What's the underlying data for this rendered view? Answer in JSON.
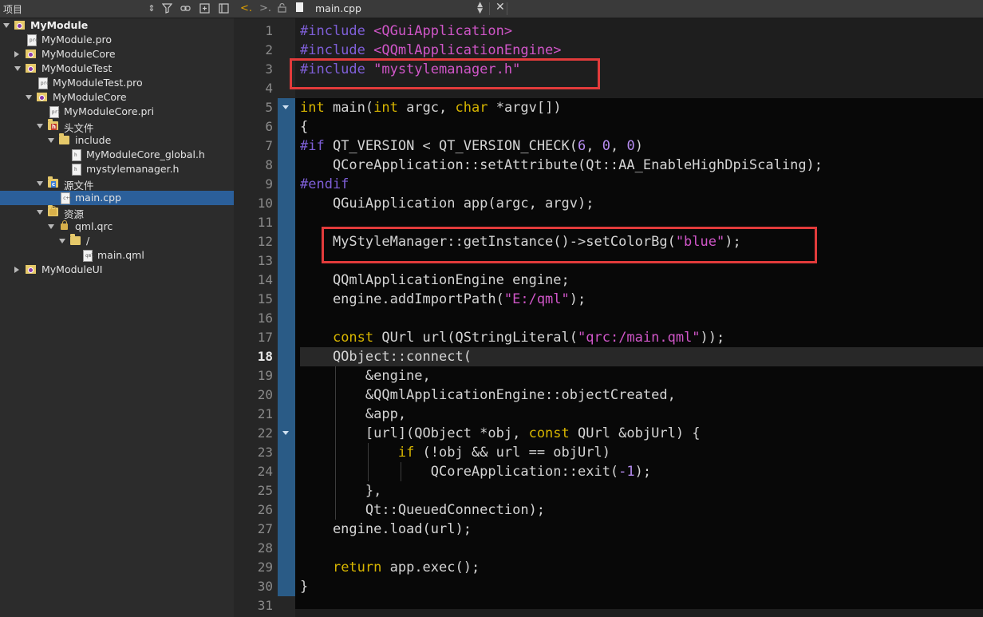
{
  "panel": {
    "title": "项目"
  },
  "tree": [
    {
      "label": "MyModule",
      "icon": "project-icon",
      "bold": true,
      "arrow": "down"
    },
    {
      "label": "MyModule.pro",
      "icon": "pro-file-icon",
      "arrow": ""
    },
    {
      "label": "MyModuleCore",
      "icon": "project-icon",
      "arrow": "right"
    },
    {
      "label": "MyModuleTest",
      "icon": "project-icon",
      "arrow": "down"
    },
    {
      "label": "MyModuleTest.pro",
      "icon": "pro-file-icon",
      "arrow": ""
    },
    {
      "label": "MyModuleCore",
      "icon": "project-icon",
      "arrow": "down"
    },
    {
      "label": "MyModuleCore.pri",
      "icon": "pri-file-icon",
      "arrow": ""
    },
    {
      "label": "头文件",
      "icon": "headers-folder-icon",
      "arrow": "down"
    },
    {
      "label": "include",
      "icon": "folder-icon",
      "arrow": "down"
    },
    {
      "label": "MyModuleCore_global.h",
      "icon": "header-file-icon",
      "arrow": ""
    },
    {
      "label": "mystylemanager.h",
      "icon": "header-file-icon",
      "arrow": ""
    },
    {
      "label": "源文件",
      "icon": "sources-folder-icon",
      "arrow": "down"
    },
    {
      "label": "main.cpp",
      "icon": "cpp-file-icon",
      "arrow": "",
      "selected": true
    },
    {
      "label": "资源",
      "icon": "resources-folder-icon",
      "arrow": "down"
    },
    {
      "label": "qml.qrc",
      "icon": "qrc-file-icon",
      "arrow": "down"
    },
    {
      "label": "/",
      "icon": "folder-icon",
      "arrow": "down"
    },
    {
      "label": "main.qml",
      "icon": "qml-file-icon",
      "arrow": ""
    },
    {
      "label": "MyModuleUI",
      "icon": "project-icon",
      "arrow": "right"
    }
  ],
  "editor": {
    "file_name": "main.cpp",
    "current_line": 18
  },
  "code_lines": [
    "#include <QGuiApplication>",
    "#include <QQmlApplicationEngine>",
    "#include \"mystylemanager.h\"",
    "",
    "int main(int argc, char *argv[])",
    "{",
    "#if QT_VERSION < QT_VERSION_CHECK(6, 0, 0)",
    "    QCoreApplication::setAttribute(Qt::AA_EnableHighDpiScaling);",
    "#endif",
    "    QGuiApplication app(argc, argv);",
    "",
    "    MyStyleManager::getInstance()->setColorBg(\"blue\");",
    "",
    "    QQmlApplicationEngine engine;",
    "    engine.addImportPath(\"E:/qml\");",
    "",
    "    const QUrl url(QStringLiteral(\"qrc:/main.qml\"));",
    "    QObject::connect(",
    "        &engine,",
    "        &QQmlApplicationEngine::objectCreated,",
    "        &app,",
    "        [url](QObject *obj, const QUrl &objUrl) {",
    "            if (!obj && url == objUrl)",
    "                QCoreApplication::exit(-1);",
    "        },",
    "        Qt::QueuedConnection);",
    "    engine.load(url);",
    "",
    "    return app.exec();",
    "}",
    ""
  ],
  "line_numbers": [
    "1",
    "2",
    "3",
    "4",
    "5",
    "6",
    "7",
    "8",
    "9",
    "10",
    "11",
    "12",
    "13",
    "14",
    "15",
    "16",
    "17",
    "18",
    "19",
    "20",
    "21",
    "22",
    "23",
    "24",
    "25",
    "26",
    "27",
    "28",
    "29",
    "30",
    "31"
  ],
  "colors": {
    "highlight_box": "#e23b3b",
    "selection": "#2b5f9a",
    "keyword": "#d7b500",
    "preprocessor": "#7f5fd8",
    "string": "#d056c8"
  }
}
